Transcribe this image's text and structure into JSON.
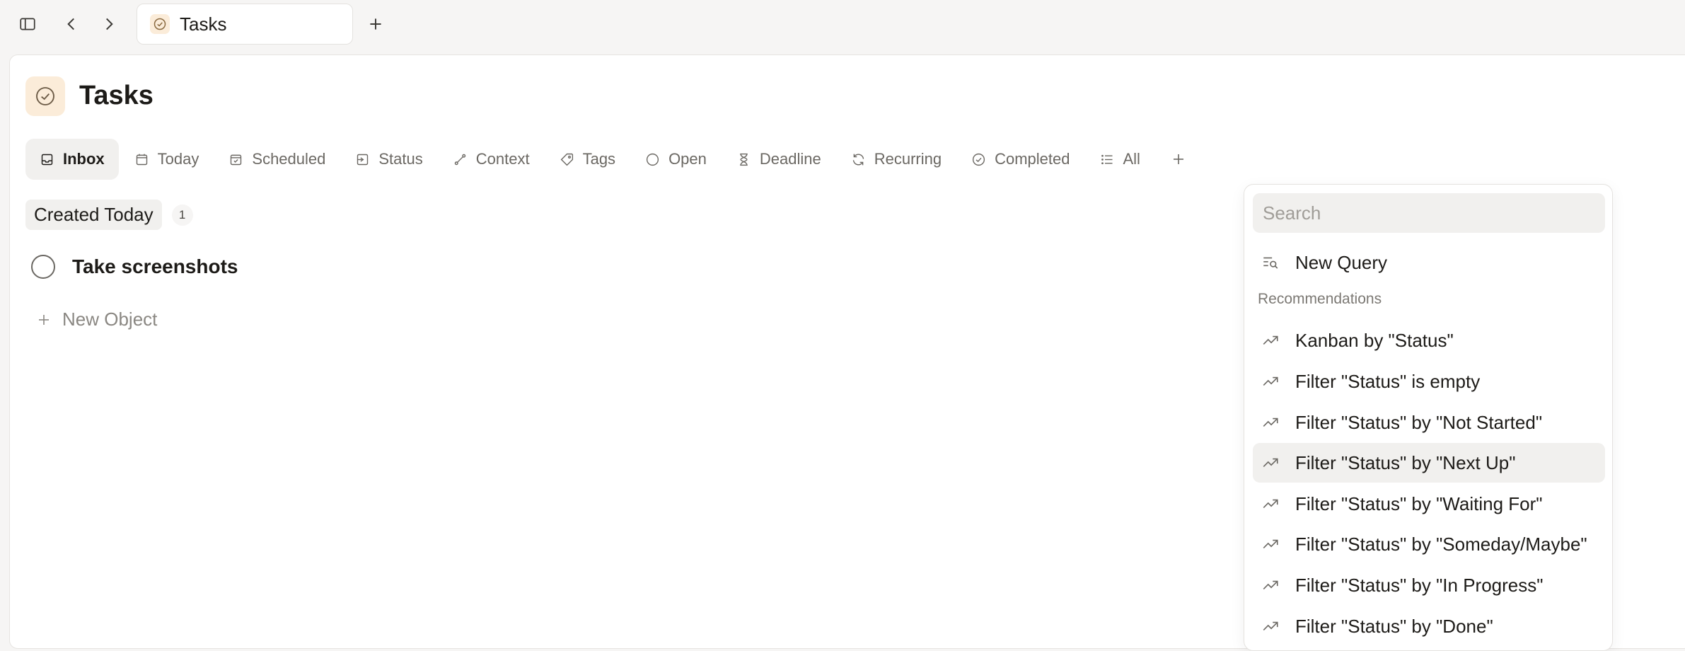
{
  "topbar": {
    "sidebar_toggle": "sidebar-icon",
    "back": "chevron-left-icon",
    "forward": "chevron-right-icon",
    "tab_label": "Tasks",
    "new_tab": "plus-icon"
  },
  "page": {
    "title": "Tasks"
  },
  "views": [
    {
      "label": "Inbox",
      "icon": "inbox-icon",
      "active": true
    },
    {
      "label": "Today",
      "icon": "calendar-today-icon"
    },
    {
      "label": "Scheduled",
      "icon": "calendar-check-icon"
    },
    {
      "label": "Status",
      "icon": "status-icon"
    },
    {
      "label": "Context",
      "icon": "context-icon"
    },
    {
      "label": "Tags",
      "icon": "tag-icon"
    },
    {
      "label": "Open",
      "icon": "circle-icon"
    },
    {
      "label": "Deadline",
      "icon": "hourglass-icon"
    },
    {
      "label": "Recurring",
      "icon": "refresh-icon"
    },
    {
      "label": "Completed",
      "icon": "check-circle-icon"
    },
    {
      "label": "All",
      "icon": "list-icon"
    }
  ],
  "group": {
    "title": "Created Today",
    "count": "1"
  },
  "tasks": [
    {
      "title": "Take screenshots"
    }
  ],
  "new_object_label": "New Object",
  "dropdown": {
    "search_placeholder": "Search",
    "new_query_label": "New Query",
    "section_label": "Recommendations",
    "items": [
      {
        "label": "Kanban by \"Status\""
      },
      {
        "label": "Filter \"Status\" is empty"
      },
      {
        "label": "Filter \"Status\" by \"Not Started\""
      },
      {
        "label": "Filter \"Status\" by \"Next Up\"",
        "highlighted": true
      },
      {
        "label": "Filter \"Status\" by \"Waiting For\""
      },
      {
        "label": "Filter \"Status\" by \"Someday/Maybe\""
      },
      {
        "label": "Filter \"Status\" by \"In Progress\""
      },
      {
        "label": "Filter \"Status\" by \"Done\""
      }
    ]
  },
  "colors": {
    "accent_bg": "#fbecd9",
    "accent_stroke": "#b08a5a"
  }
}
